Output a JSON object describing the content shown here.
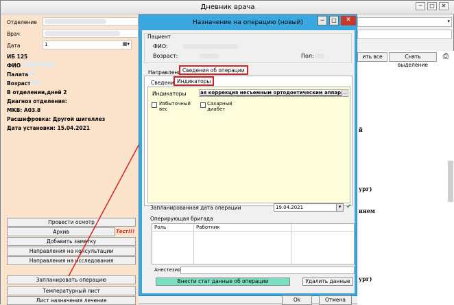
{
  "main_window": {
    "title": "Дневник врача",
    "controls": {
      "minimize": "─",
      "maximize": "□",
      "close": "✕"
    }
  },
  "left_panel": {
    "fields": [
      {
        "label": "Отделение"
      },
      {
        "label": "Врач"
      },
      {
        "label": "Дата",
        "value": "1"
      }
    ],
    "info": {
      "ib": "ИБ 125",
      "fio": "ФИО",
      "palata": "Палата",
      "vozrast": "Возраст",
      "in_dept": "В отделении,дней 2",
      "diag_label": "Диагноз отделения:",
      "mkb": "МКВ: A03.8",
      "decode": "Расшифровка: Другой шигеллез",
      "install_date": "Дата установки: 15.04.2021"
    },
    "buttons": {
      "conduct_exam": "Провести осмотр",
      "archive": "Архив",
      "test_badge": "Тест!!!",
      "add_note": "Добавить заметку",
      "consult": "Направления на консультации",
      "research": "Направления на исследования",
      "plan_op": "Запланировать операцию",
      "temp_sheet": "Температурный лист",
      "treatment_sheet": "Лист назначения лечения"
    }
  },
  "right_strip": {
    "select_all": "ить все",
    "deselect": "Снять выделение",
    "fragments": [
      "й",
      "ург)",
      "нием",
      "ург)"
    ]
  },
  "dialog": {
    "title": "Назначение на операцию (новый)",
    "patient_group": "Пациент",
    "fio_label": "ФИО:",
    "age_label": "Возраст:",
    "sex_label": "Пол:",
    "tabs": [
      {
        "label": "Направление"
      },
      {
        "label": "Сведения об операции"
      }
    ],
    "subtabs": [
      {
        "label": "Сведения"
      },
      {
        "label": "Индикаторы"
      }
    ],
    "indicators_label": "Индикаторы",
    "indicators_value": "ая коррекция несъемным ортодонтическим аппаратом.",
    "checkboxes": [
      {
        "label": "Избыточный вес",
        "checked": false
      },
      {
        "label": "Сахарный диабет",
        "checked": false
      }
    ],
    "planned_date_label": "Запланированная дата операции",
    "planned_date": "19.04.2021",
    "team_label": "Оперирующая бригада",
    "team_columns": [
      "Роль",
      "Работник"
    ],
    "anesth_label": "Анестезиолог",
    "apply_button": "Внести стат данные об операции",
    "delete_button": "Удалить данные",
    "ok": "Ok",
    "cancel": "Отмена"
  },
  "colors": {
    "dialog_frame": "#3aa8de",
    "left_panel": "#fbe3cc",
    "indicator_panel": "#fefedc",
    "apply_button": "#7ae0c2",
    "highlight_red": "#d82020"
  }
}
